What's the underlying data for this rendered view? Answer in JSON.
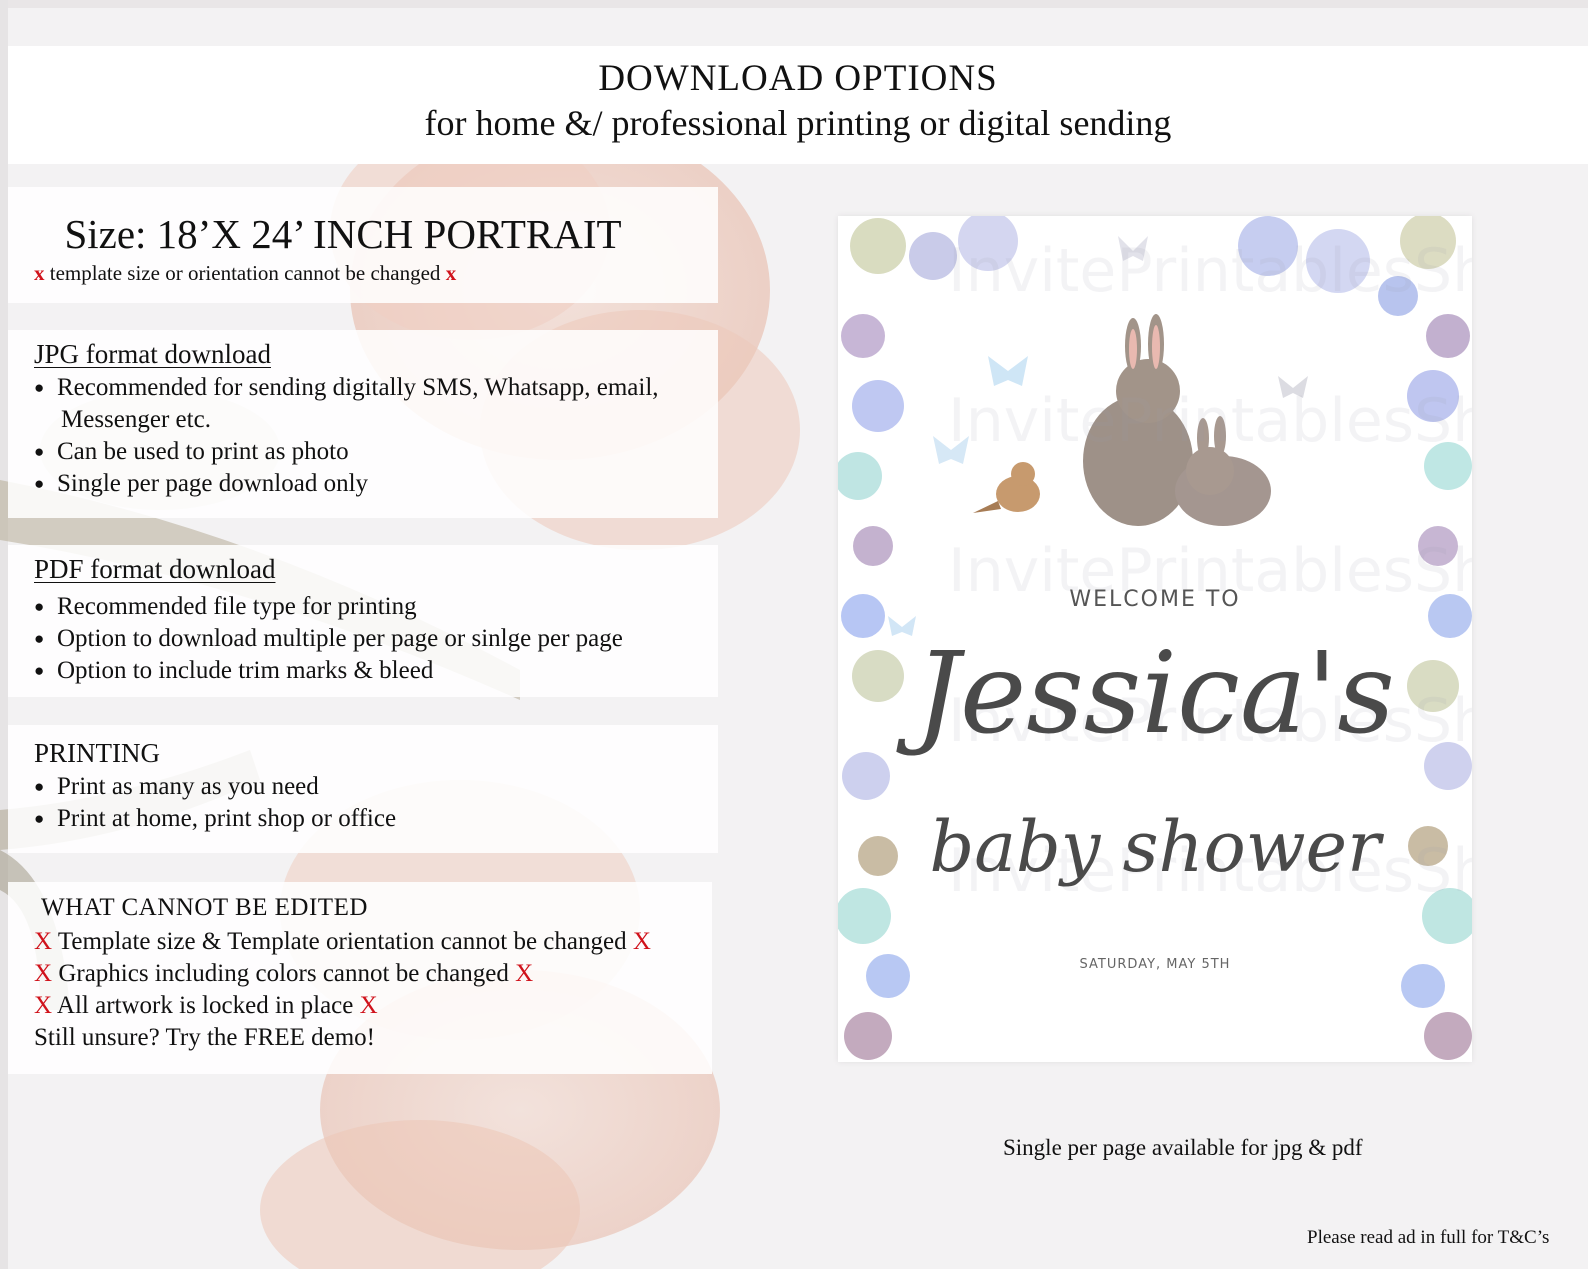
{
  "header": {
    "title": "DOWNLOAD OPTIONS",
    "subtitle": "for home &/ professional printing or digital sending"
  },
  "size": {
    "title": "Size: 18’X 24’ INCH PORTRAIT",
    "mark": "x",
    "note": " template size or orientation cannot be changed "
  },
  "jpg": {
    "title": "JPG format download",
    "bullets": [
      "Recommended for sending digitally SMS, Whatsapp, email,",
      "Can be used to print as photo",
      "Single per page download only"
    ],
    "bullet0_cont": "Messenger etc."
  },
  "pdf": {
    "title": "PDF format download",
    "bullets": [
      "Recommended file type for printing",
      "Option to download multiple per page or sinlge per page",
      "Option to include trim marks & bleed"
    ]
  },
  "printing": {
    "title": "PRINTING",
    "bullets": [
      "Print as many as you need",
      "Print at home, print shop or office"
    ]
  },
  "edit": {
    "title": "WHAT CANNOT BE EDITED",
    "mark": "X",
    "lines": [
      " Template size & Template orientation cannot be changed ",
      " Graphics including colors cannot be changed ",
      " All artwork is locked in place "
    ],
    "demo": "Still unsure? Try the FREE demo!"
  },
  "preview": {
    "welcome": "WELCOME TO",
    "name": "Jessica's",
    "event": "baby shower",
    "date": "SATURDAY, MAY 5TH",
    "watermark": "InvitePrintablesShop"
  },
  "caption": "Single per page available for jpg & pdf",
  "footnote": "Please read ad in full for T&C’s",
  "colors": {
    "accent_red": "#d0121b",
    "panel": "#ffffff",
    "background": "#f3f2f3"
  }
}
